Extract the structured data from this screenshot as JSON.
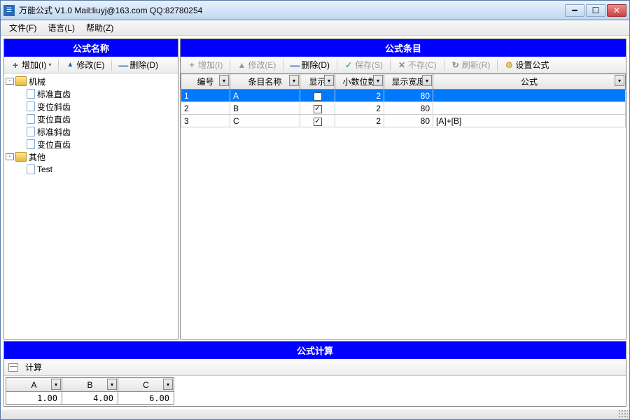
{
  "title": "万能公式 V1.0    Mail:liuyj@163.com QQ:82780254",
  "menu": {
    "file": "文件(F)",
    "lang": "语言(L)",
    "help": "帮助(Z)"
  },
  "left": {
    "header": "公式名称",
    "toolbar": {
      "add": "增加(I)",
      "edit": "修改(E)",
      "delete": "删除(D)"
    },
    "tree": {
      "n0": "机械",
      "n0c": [
        "标准直齿",
        "变位斜齿",
        "变位直齿",
        "标准斜齿",
        "变位直齿"
      ],
      "n1": "其他",
      "n1c": [
        "Test"
      ]
    }
  },
  "right": {
    "header": "公式条目",
    "toolbar": {
      "add": "增加(I)",
      "edit": "修改(E)",
      "delete": "删除(D)",
      "save": "保存(S)",
      "nosave": "不存(C)",
      "refresh": "刷新(R)",
      "formula": "设置公式"
    },
    "cols": [
      "编号",
      "条目名称",
      "显示",
      "小数位数",
      "显示宽度",
      "公式"
    ],
    "rows": [
      {
        "id": "1",
        "name": "A",
        "show": true,
        "dec": "2",
        "width": "80",
        "formula": ""
      },
      {
        "id": "2",
        "name": "B",
        "show": true,
        "dec": "2",
        "width": "80",
        "formula": ""
      },
      {
        "id": "3",
        "name": "C",
        "show": true,
        "dec": "2",
        "width": "80",
        "formula": "[A]+[B]"
      }
    ]
  },
  "bottom": {
    "header": "公式计算",
    "calc_label": "计算",
    "cols": [
      "A",
      "B",
      "C"
    ],
    "vals": [
      "1.00",
      "4.00",
      "6.00"
    ]
  }
}
